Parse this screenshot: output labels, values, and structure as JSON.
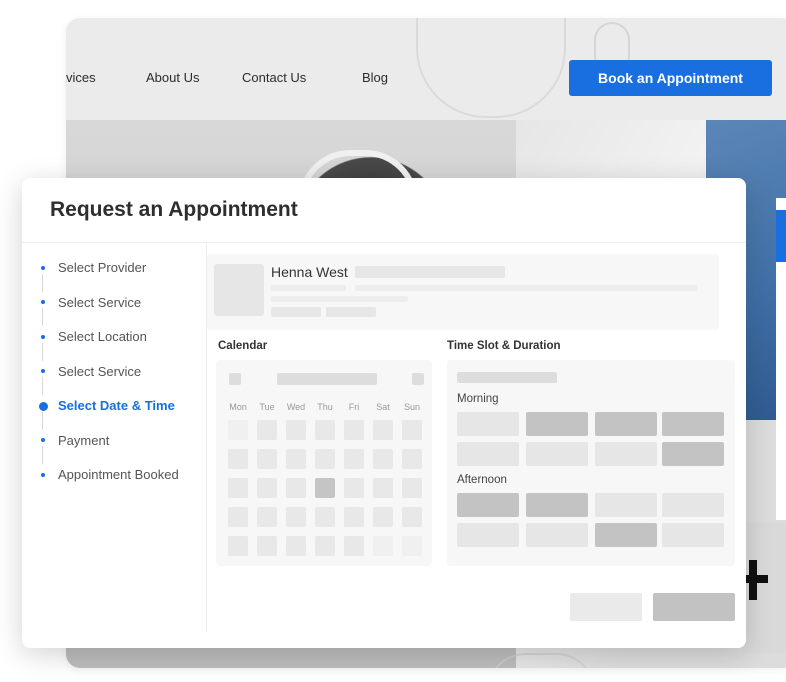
{
  "background_site": {
    "nav_links": [
      "vices",
      "About Us",
      "Contact Us",
      "Blog"
    ],
    "cta_label": "Book an Appointment",
    "accent_color": "#1a6fe0"
  },
  "modal": {
    "title": "Request an Appointment",
    "steps": [
      {
        "label": "Select Provider",
        "state": "default"
      },
      {
        "label": "Select Service",
        "state": "default"
      },
      {
        "label": "Select Location",
        "state": "default"
      },
      {
        "label": "Select Service",
        "state": "default"
      },
      {
        "label": "Select Date & Time",
        "state": "active"
      },
      {
        "label": "Payment",
        "state": "default"
      },
      {
        "label": "Appointment Booked",
        "state": "default"
      }
    ],
    "provider": {
      "name": "Henna West"
    },
    "calendar": {
      "title": "Calendar",
      "weekdays": [
        "Mon",
        "Tue",
        "Wed",
        "Thu",
        "Fri",
        "Sat",
        "Sun"
      ]
    },
    "timeslots": {
      "title": "Time Slot & Duration",
      "morning_label": "Morning",
      "afternoon_label": "Afternoon"
    }
  }
}
